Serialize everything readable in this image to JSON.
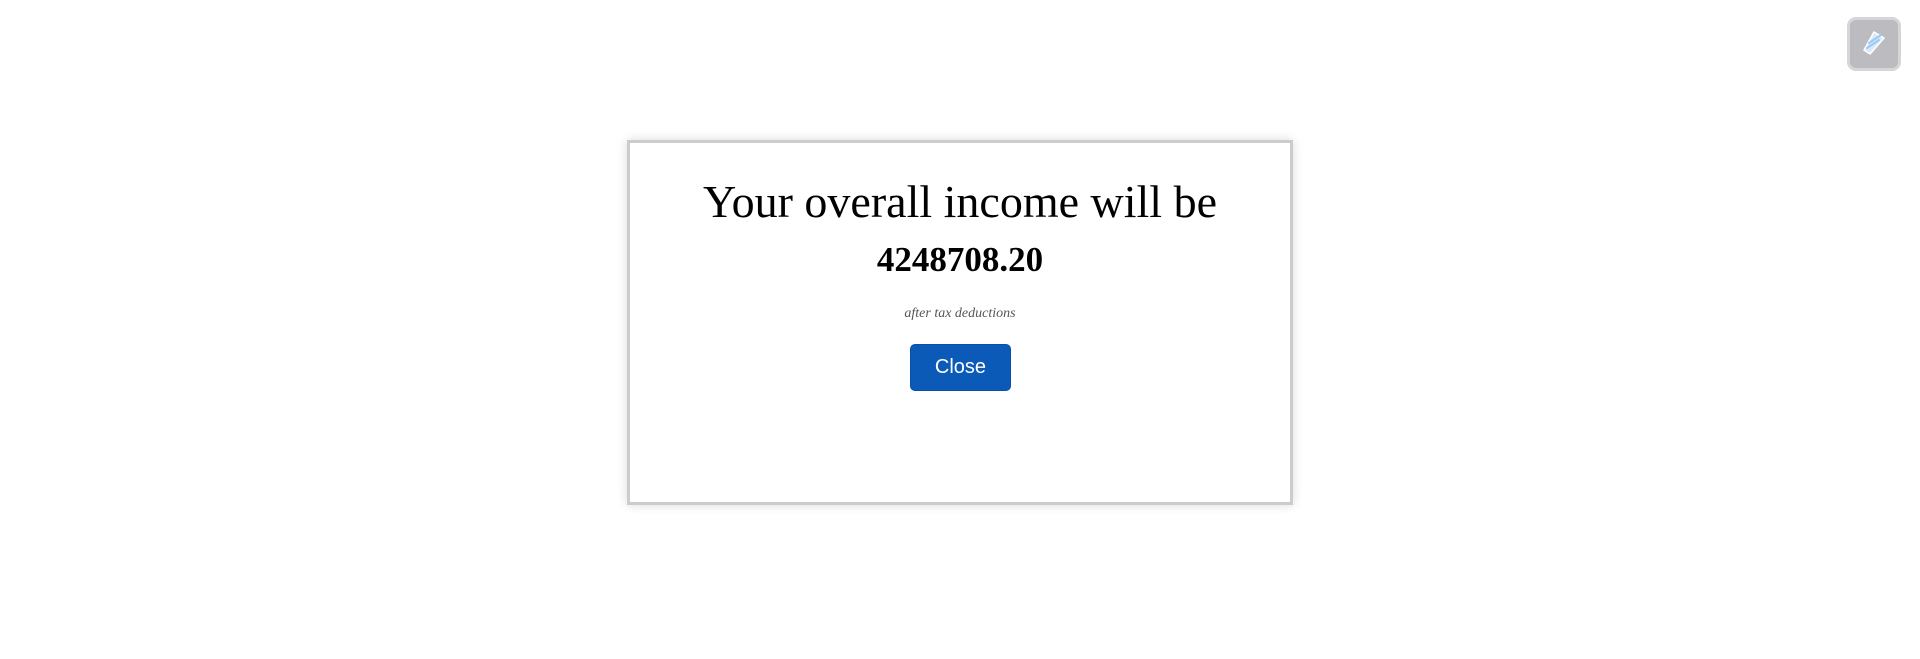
{
  "modal": {
    "title": "Your overall income will be",
    "income_value": "4248708.20",
    "note": "after tax deductions",
    "close_label": "Close"
  },
  "corner_widget": {
    "icon": "extension-icon"
  },
  "colors": {
    "button_bg": "#0b5ab8",
    "button_text": "#ffffff",
    "modal_border": "#cccccc",
    "note_text": "#555555",
    "widget_bg": "#bcbcc0"
  }
}
